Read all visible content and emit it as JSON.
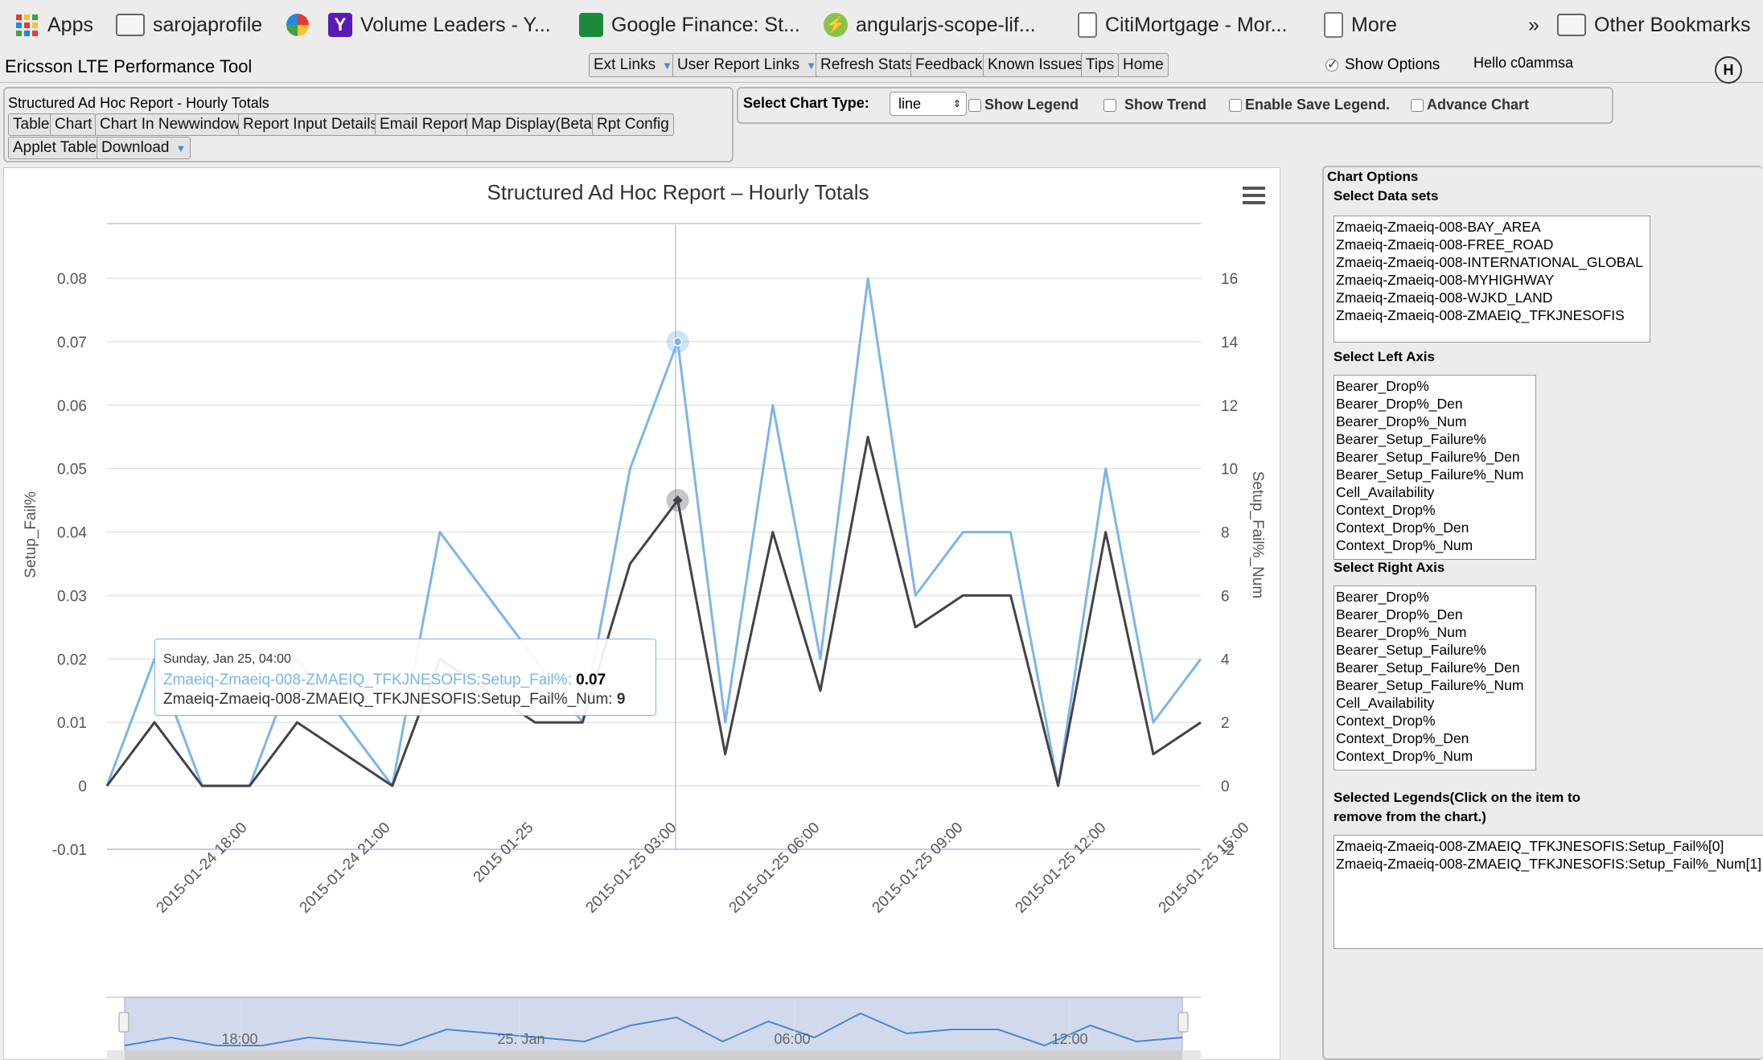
{
  "bookmarks": {
    "apps": "Apps",
    "items": [
      "sarojaprofile",
      "",
      "Volume Leaders - Y...",
      "Google Finance: St...",
      "angularjs-scope-lif...",
      "CitiMortgage - Mor...",
      "More"
    ],
    "overflow": "»",
    "other": "Other Bookmarks"
  },
  "app": {
    "title": "Ericsson LTE Performance Tool",
    "nav": [
      "Ext Links",
      "User Report Links",
      "Refresh Stats",
      "Feedback",
      "Known Issues",
      "Tips",
      "Home"
    ],
    "show_options": "Show Options",
    "greeting": "Hello c0ammsa",
    "help_badge": "H"
  },
  "report": {
    "title": "Structured Ad Hoc Report - Hourly Totals",
    "buttons_row1": [
      "Table",
      "Chart",
      "Chart In Newwindow",
      "Report Input Details",
      "Email Report",
      "Map Display(Beta)",
      "Rpt Config"
    ],
    "buttons_row2": [
      "Applet Table",
      "Download"
    ]
  },
  "chart_controls": {
    "label": "Select Chart Type:",
    "chart_type": "line",
    "checkboxes": [
      "Show Legend",
      "Show Trend",
      "Enable Save Legend.",
      "Advance Chart"
    ]
  },
  "options": {
    "title": "Chart Options",
    "datasets_label": "Select Data sets",
    "datasets": [
      "Zmaeiq-Zmaeiq-008-BAY_AREA",
      "Zmaeiq-Zmaeiq-008-FREE_ROAD",
      "Zmaeiq-Zmaeiq-008-INTERNATIONAL_GLOBAL",
      "Zmaeiq-Zmaeiq-008-MYHIGHWAY",
      "Zmaeiq-Zmaeiq-008-WJKD_LAND",
      "Zmaeiq-Zmaeiq-008-ZMAEIQ_TFKJNESOFIS"
    ],
    "left_axis_label": "Select Left Axis",
    "left_axis": [
      "Bearer_Drop%",
      "Bearer_Drop%_Den",
      "Bearer_Drop%_Num",
      "Bearer_Setup_Failure%",
      "Bearer_Setup_Failure%_Den",
      "Bearer_Setup_Failure%_Num",
      "Cell_Availability",
      "Context_Drop%",
      "Context_Drop%_Den",
      "Context_Drop%_Num"
    ],
    "right_axis_label": "Select Right Axis",
    "right_axis": [
      "Bearer_Drop%",
      "Bearer_Drop%_Den",
      "Bearer_Drop%_Num",
      "Bearer_Setup_Failure%",
      "Bearer_Setup_Failure%_Den",
      "Bearer_Setup_Failure%_Num",
      "Cell_Availability",
      "Context_Drop%",
      "Context_Drop%_Den",
      "Context_Drop%_Num"
    ],
    "legends_label_1": "Selected Legends(Click on the item to",
    "legends_label_2": "remove from the chart.)",
    "legends": [
      "Zmaeiq-Zmaeiq-008-ZMAEIQ_TFKJNESOFIS:Setup_Fail%[0]",
      "Zmaeiq-Zmaeiq-008-ZMAEIQ_TFKJNESOFIS:Setup_Fail%_Num[1]"
    ]
  },
  "tooltip": {
    "date": "Sunday, Jan 25, 04:00",
    "line1_label": "Zmaeiq-Zmaeiq-008-ZMAEIQ_TFKJNESOFIS:Setup_Fail%: ",
    "line1_value": "0.07",
    "line2_label": "Zmaeiq-Zmaeiq-008-ZMAEIQ_TFKJNESOFIS:Setup_Fail%_Num: ",
    "line2_value": "9"
  },
  "colors": {
    "series1": "#7cb5ec",
    "series2": "#434348"
  },
  "chart_data": {
    "type": "line",
    "title": "Structured Ad Hoc Report – Hourly Totals",
    "ylabel": "Setup_Fail%",
    "y2label": "Setup_Fail%_Num",
    "ylim": [
      -0.01,
      0.08
    ],
    "y2lim": [
      -2,
      16
    ],
    "yticks": [
      "-0.01",
      "0",
      "0.01",
      "0.02",
      "0.03",
      "0.04",
      "0.05",
      "0.06",
      "0.07",
      "0.08"
    ],
    "y2ticks": [
      "-2",
      "0",
      "2",
      "4",
      "6",
      "8",
      "10",
      "12",
      "14",
      "16"
    ],
    "xticks": [
      "2015-01-24 18:00",
      "2015-01-24 21:00",
      "2015 01-25",
      "2015-01-25 03:00",
      "2015-01-25 06:00",
      "2015-01-25 09:00",
      "2015-01-25 12:00",
      "2015-01-25 15:00"
    ],
    "x": [
      "2015-01-24 16:00",
      "2015-01-24 17:00",
      "2015-01-24 18:00",
      "2015-01-24 19:00",
      "2015-01-24 20:00",
      "2015-01-24 21:00",
      "2015-01-24 22:00",
      "2015-01-24 23:00",
      "2015-01-25 00:00",
      "2015-01-25 01:00",
      "2015-01-25 02:00",
      "2015-01-25 03:00",
      "2015-01-25 04:00",
      "2015-01-25 05:00",
      "2015-01-25 06:00",
      "2015-01-25 07:00",
      "2015-01-25 08:00",
      "2015-01-25 09:00",
      "2015-01-25 10:00",
      "2015-01-25 11:00",
      "2015-01-25 12:00",
      "2015-01-25 13:00",
      "2015-01-25 14:00",
      "2015-01-25 15:00"
    ],
    "series": [
      {
        "name": "Zmaeiq-Zmaeiq-008-ZMAEIQ_TFKJNESOFIS:Setup_Fail%",
        "axis": "left",
        "values": [
          0,
          0.02,
          0,
          0,
          0.02,
          0.01,
          0,
          0.04,
          0.03,
          0.02,
          0.01,
          0.05,
          0.07,
          0.01,
          0.06,
          0.02,
          0.08,
          0.03,
          0.04,
          0.04,
          0,
          0.05,
          0.01,
          0.02
        ]
      },
      {
        "name": "Zmaeiq-Zmaeiq-008-ZMAEIQ_TFKJNESOFIS:Setup_Fail%_Num",
        "axis": "right",
        "values": [
          0,
          2,
          0,
          0,
          2,
          1,
          0,
          4,
          3,
          2,
          2,
          7,
          9,
          1,
          8,
          3,
          11,
          5,
          6,
          6,
          0,
          8,
          1,
          2
        ]
      }
    ],
    "navigator_labels": [
      "18:00",
      "25. Jan",
      "06:00",
      "12:00"
    ],
    "grid": true
  }
}
